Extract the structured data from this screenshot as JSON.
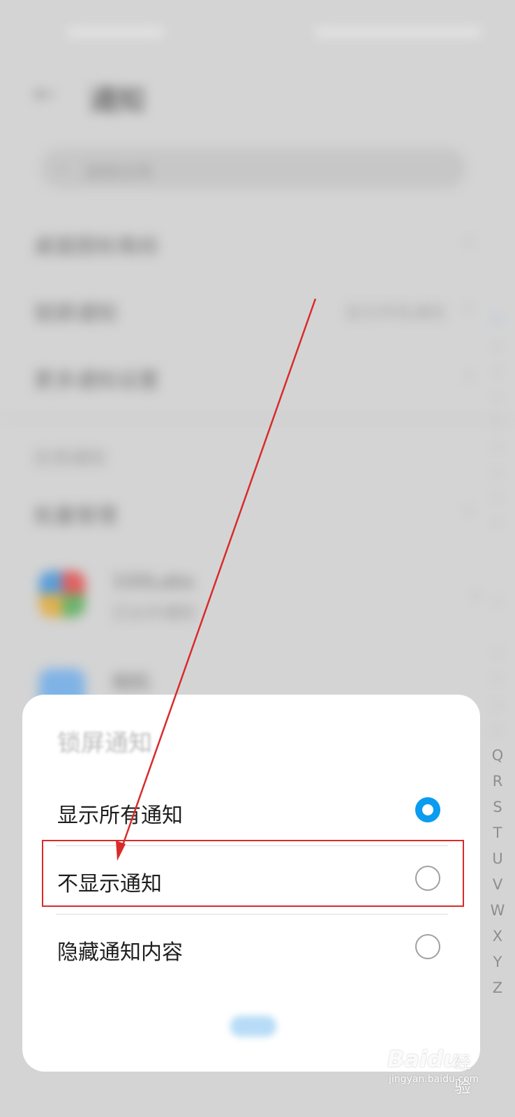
{
  "background": {
    "header": {
      "title": "通知",
      "back_icon": "back-arrow-icon"
    },
    "search": {
      "placeholder": "搜索应用",
      "icon": "search-icon"
    },
    "rows": [
      {
        "label": "桌面图标角标",
        "value": ""
      },
      {
        "label": "锁屏通知",
        "value": "显示所有通知"
      },
      {
        "label": "更多通知设置",
        "value": ""
      }
    ],
    "section_label": "应用通知",
    "batch_row": {
      "label": "批量管理"
    },
    "apps": [
      {
        "name": "100Labs",
        "subtitle": "已允许通知"
      },
      {
        "name": "相机",
        "subtitle": ""
      }
    ],
    "index_letters": [
      "Q",
      "R",
      "S",
      "T",
      "U",
      "V",
      "W",
      "X",
      "Y",
      "Z"
    ]
  },
  "dialog": {
    "title": "锁屏通知",
    "options": [
      {
        "label": "显示所有通知",
        "selected": true
      },
      {
        "label": "不显示通知",
        "selected": false
      },
      {
        "label": "隐藏通知内容",
        "selected": false
      }
    ],
    "confirm_label": "取消"
  },
  "annotation": {
    "color": "#d92a2a",
    "highlighted_option": "不显示通知"
  },
  "watermark": {
    "brand": "Baidu",
    "label": "经验",
    "url": "jingyan.baidu.com"
  },
  "colors": {
    "accent": "#0a9cf0",
    "annotation_red": "#d92a2a"
  }
}
